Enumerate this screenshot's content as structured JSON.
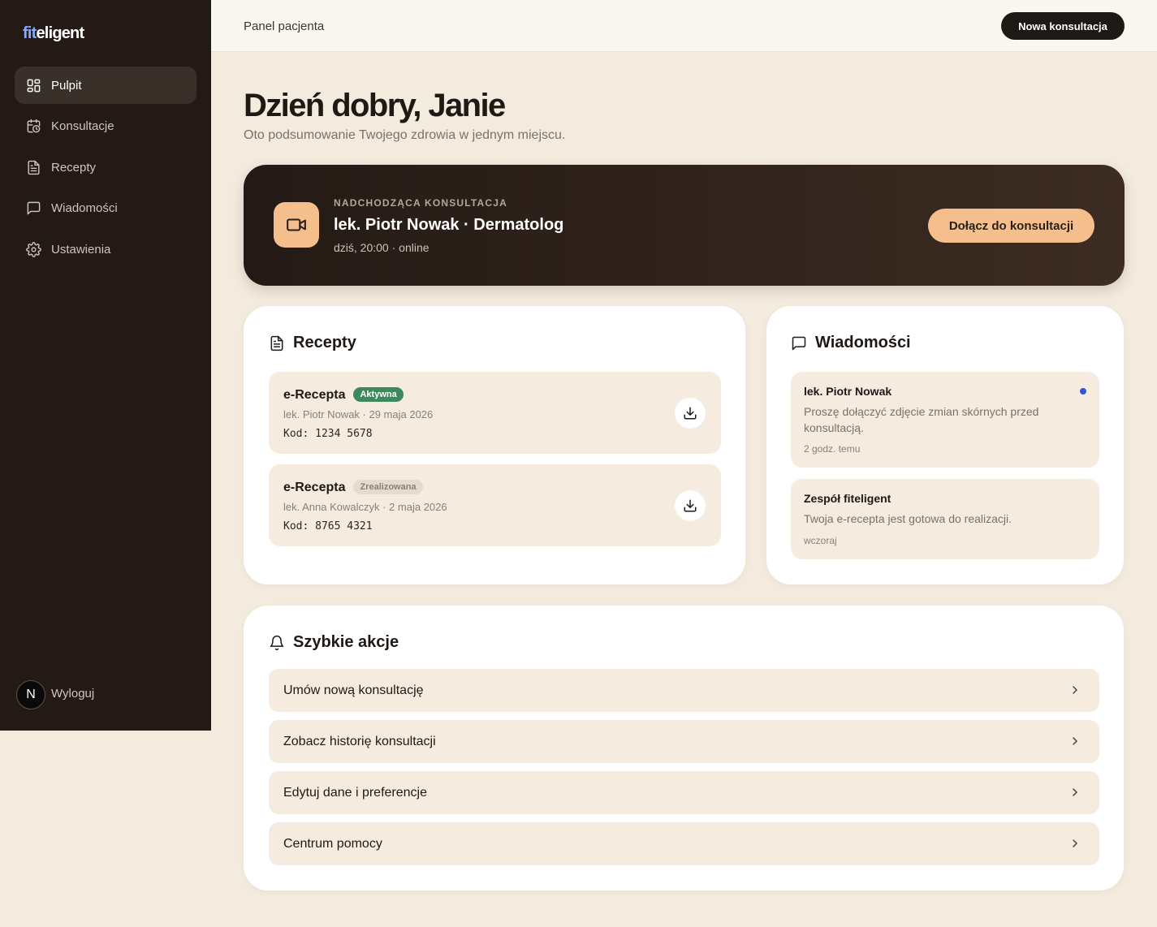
{
  "sidebar": {
    "logo": {
      "part1": "fit",
      "part2": "eligent"
    },
    "items": [
      {
        "label": "Pulpit",
        "icon": "grid-icon"
      },
      {
        "label": "Konsultacje",
        "icon": "calendar-clock-icon"
      },
      {
        "label": "Recepty",
        "icon": "document-icon"
      },
      {
        "label": "Wiadomości",
        "icon": "message-icon"
      },
      {
        "label": "Ustawienia",
        "icon": "gear-icon"
      }
    ],
    "avatar_initial": "N",
    "logout_label": "Wyloguj"
  },
  "header": {
    "title": "Panel pacjenta",
    "new_consult_label": "Nowa konsultacja"
  },
  "main": {
    "greeting": "Dzień dobry, Janie",
    "subtitle": "Oto podsumowanie Twojego zdrowia w jednym miejscu."
  },
  "upcoming": {
    "overline": "NADCHODZĄCA KONSULTACJA",
    "title": "lek. Piotr Nowak · Dermatolog",
    "meta": "dziś, 20:00 · online",
    "join_label": "Dołącz do konsultacji"
  },
  "prescriptions": {
    "title": "Recepty",
    "items": [
      {
        "name": "e-Recepta",
        "status": "Aktywna",
        "meta": "lek. Piotr Nowak · 29 maja 2026",
        "code": "Kod: 1234 5678"
      },
      {
        "name": "e-Recepta",
        "status": "Zrealizowana",
        "meta": "lek. Anna Kowalczyk · 2 maja 2026",
        "code": "Kod: 8765 4321"
      }
    ]
  },
  "messages": {
    "title": "Wiadomości",
    "items": [
      {
        "from": "lek. Piotr Nowak",
        "text": "Proszę dołączyć zdjęcie zmian skórnych przed konsultacją.",
        "time": "2 godz. temu",
        "unread": true
      },
      {
        "from": "Zespół fiteligent",
        "text": "Twoja e-recepta jest gotowa do realizacji.",
        "time": "wczoraj",
        "unread": false
      }
    ]
  },
  "quick_actions": {
    "title": "Szybkie akcje",
    "items": [
      {
        "label": "Umów nową konsultację"
      },
      {
        "label": "Zobacz historię konsultacji"
      },
      {
        "label": "Edytuj dane i preferencje"
      },
      {
        "label": "Centrum pomocy"
      }
    ]
  },
  "colors": {
    "sidebar_bg": "#231a15",
    "page_bg": "#f4ebdf",
    "accent_peach": "#f4bf8c",
    "badge_active": "#3c8a5b",
    "unread_dot": "#2e55d6"
  }
}
